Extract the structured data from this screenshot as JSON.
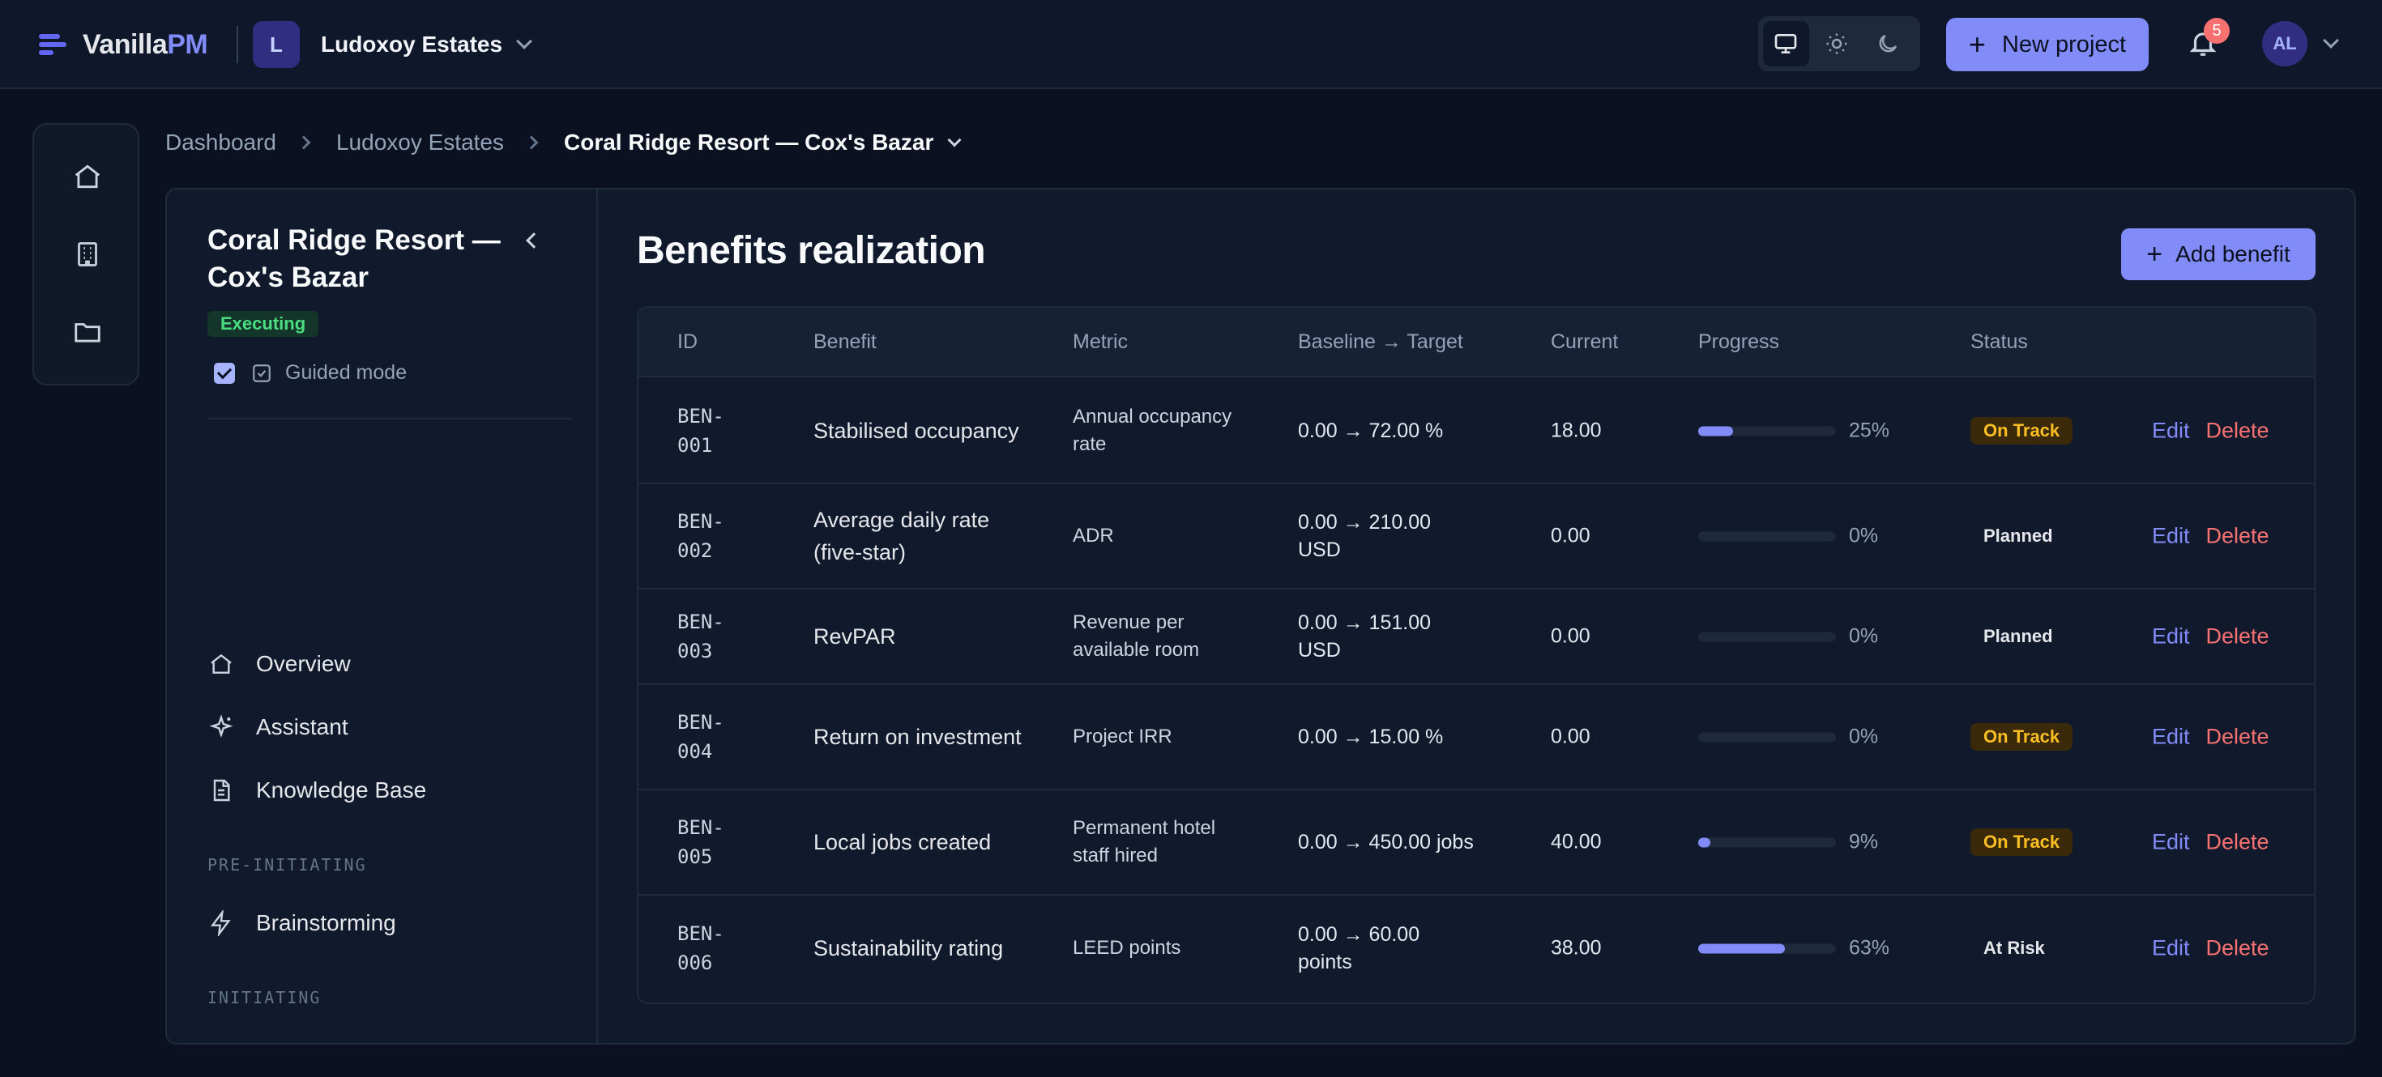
{
  "brand": {
    "name_main": "Vanilla",
    "name_accent": "PM",
    "accent_color": "#818cf8"
  },
  "org": {
    "initial": "L",
    "name": "Ludoxoy Estates"
  },
  "header": {
    "new_project_label": "New project",
    "notifications_count": "5",
    "user_initials": "AL"
  },
  "breadcrumb": {
    "items": [
      "Dashboard",
      "Ludoxoy Estates"
    ],
    "current": "Coral Ridge Resort — Cox's Bazar"
  },
  "project": {
    "title": "Coral Ridge Resort — Cox's Bazar",
    "status": "Executing",
    "guided_mode_label": "Guided mode",
    "guided_mode_checked": true
  },
  "sidenav": {
    "items": [
      {
        "label": "Overview",
        "icon": "home-icon"
      },
      {
        "label": "Assistant",
        "icon": "sparkle-icon"
      },
      {
        "label": "Knowledge Base",
        "icon": "document-icon"
      }
    ],
    "sections": [
      {
        "title": "PRE-INITIATING",
        "items": [
          {
            "label": "Brainstorming",
            "icon": "lightning-icon"
          }
        ]
      },
      {
        "title": "INITIATING",
        "items": []
      }
    ]
  },
  "main": {
    "title": "Benefits realization",
    "add_label": "Add benefit",
    "table": {
      "columns": [
        "ID",
        "Benefit",
        "Metric",
        "Baseline → Target",
        "Current",
        "Progress",
        "Status"
      ],
      "edit_label": "Edit",
      "delete_label": "Delete",
      "rows": [
        {
          "id": "BEN-001",
          "benefit": "Stabilised occupancy",
          "metric": "Annual occupancy rate",
          "baseline_target": "0.00 → 72.00 %",
          "current": "18.00",
          "progress": 25,
          "progress_label": "25%",
          "status": "On Track"
        },
        {
          "id": "BEN-002",
          "benefit": "Average daily rate (five-star)",
          "metric": "ADR",
          "baseline_target": "0.00 → 210.00 USD",
          "current": "0.00",
          "progress": 0,
          "progress_label": "0%",
          "status": "Planned"
        },
        {
          "id": "BEN-003",
          "benefit": "RevPAR",
          "metric": "Revenue per available room",
          "baseline_target": "0.00 → 151.00 USD",
          "current": "0.00",
          "progress": 0,
          "progress_label": "0%",
          "status": "Planned"
        },
        {
          "id": "BEN-004",
          "benefit": "Return on investment",
          "metric": "Project IRR",
          "baseline_target": "0.00 → 15.00 %",
          "current": "0.00",
          "progress": 0,
          "progress_label": "0%",
          "status": "On Track"
        },
        {
          "id": "BEN-005",
          "benefit": "Local jobs created",
          "metric": "Permanent hotel staff hired",
          "baseline_target": "0.00 → 450.00 jobs",
          "current": "40.00",
          "progress": 9,
          "progress_label": "9%",
          "status": "On Track"
        },
        {
          "id": "BEN-006",
          "benefit": "Sustainability rating",
          "metric": "LEED points",
          "baseline_target": "0.00 → 60.00 points",
          "current": "38.00",
          "progress": 63,
          "progress_label": "63%",
          "status": "At Risk"
        }
      ]
    }
  }
}
